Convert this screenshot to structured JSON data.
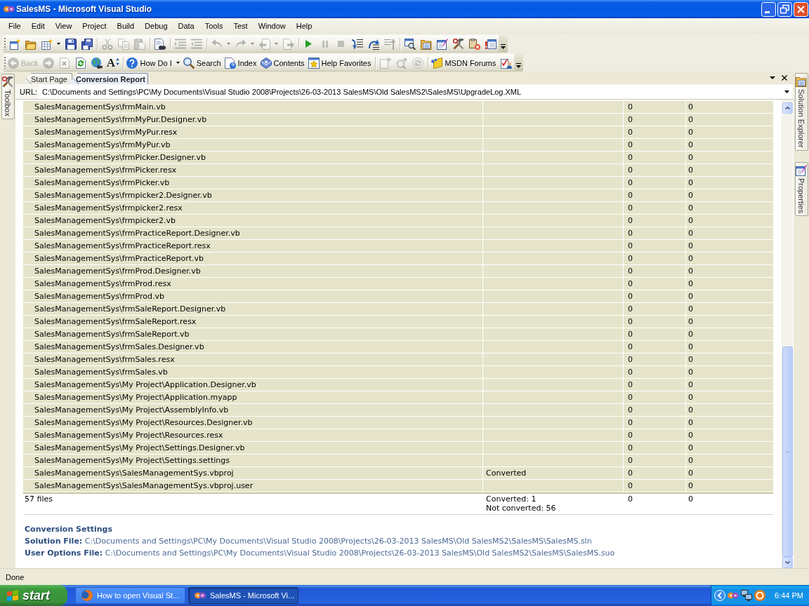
{
  "window": {
    "title": "SalesMS - Microsoft Visual Studio"
  },
  "menu": [
    "File",
    "Edit",
    "View",
    "Project",
    "Build",
    "Debug",
    "Data",
    "Tools",
    "Test",
    "Window",
    "Help"
  ],
  "toolbar_1": [
    {
      "kind": "button",
      "disabled": false
    },
    {
      "kind": "button",
      "disabled": false
    },
    {
      "kind": "button",
      "disabled": false
    },
    {
      "kind": "dropdown",
      "disabled": false
    },
    {
      "kind": "button",
      "disabled": false
    },
    {
      "kind": "button",
      "disabled": false
    },
    {
      "kind": "separator"
    },
    {
      "kind": "button",
      "disabled": true
    },
    {
      "kind": "button",
      "disabled": true
    },
    {
      "kind": "button",
      "disabled": true
    },
    {
      "kind": "separator"
    },
    {
      "kind": "button",
      "disabled": false
    },
    {
      "kind": "separator"
    },
    {
      "kind": "button",
      "disabled": true
    },
    {
      "kind": "button",
      "disabled": true
    },
    {
      "kind": "separator"
    },
    {
      "kind": "button",
      "disabled": true
    },
    {
      "kind": "dropdown",
      "disabled": true
    },
    {
      "kind": "button",
      "disabled": true
    },
    {
      "kind": "dropdown",
      "disabled": true
    },
    {
      "kind": "button",
      "disabled": true
    },
    {
      "kind": "dropdown",
      "disabled": true
    },
    {
      "kind": "button",
      "disabled": true
    },
    {
      "kind": "separator"
    },
    {
      "kind": "button",
      "disabled": false
    },
    {
      "kind": "button",
      "disabled": true
    },
    {
      "kind": "button",
      "disabled": true
    },
    {
      "kind": "button",
      "disabled": false
    },
    {
      "kind": "button",
      "disabled": false
    },
    {
      "kind": "button",
      "disabled": true
    },
    {
      "kind": "separator"
    },
    {
      "kind": "button",
      "disabled": false
    },
    {
      "kind": "button",
      "disabled": false
    },
    {
      "kind": "button",
      "disabled": false
    },
    {
      "kind": "button",
      "disabled": false
    },
    {
      "kind": "button",
      "disabled": false
    },
    {
      "kind": "button",
      "disabled": false
    },
    {
      "kind": "overflow"
    }
  ],
  "toolbar_2": [
    {
      "kind": "button",
      "label": "Back",
      "disabled": true
    },
    {
      "kind": "button",
      "disabled": true
    },
    {
      "kind": "button",
      "disabled": true
    },
    {
      "kind": "button",
      "disabled": false
    },
    {
      "kind": "button",
      "disabled": false
    },
    {
      "kind": "button",
      "glyph": "A",
      "disabled": false
    },
    {
      "kind": "separator"
    },
    {
      "kind": "button",
      "label": "How Do I",
      "disabled": false
    },
    {
      "kind": "dropdown",
      "disabled": false
    },
    {
      "kind": "button",
      "label": "Search",
      "disabled": false
    },
    {
      "kind": "button",
      "label": "Index",
      "disabled": false
    },
    {
      "kind": "button",
      "label": "Contents",
      "disabled": false
    },
    {
      "kind": "button",
      "label": "Help Favorites",
      "disabled": false
    },
    {
      "kind": "separator"
    },
    {
      "kind": "button",
      "disabled": true
    },
    {
      "kind": "button",
      "disabled": true
    },
    {
      "kind": "button",
      "disabled": true
    },
    {
      "kind": "separator"
    },
    {
      "kind": "button",
      "label": "MSDN Forums",
      "disabled": false
    },
    {
      "kind": "button",
      "disabled": false
    },
    {
      "kind": "overflow"
    }
  ],
  "left_side_tabs": [
    {
      "label": "Toolbox"
    }
  ],
  "document_tabs": [
    {
      "label": "Start Page",
      "selected": false
    },
    {
      "label": "Conversion Report",
      "selected": true
    }
  ],
  "url_bar": {
    "label": "URL:",
    "value": "C:\\Documents and Settings\\PC\\My Documents\\Visual Studio 2008\\Projects\\26-03-2013 SalesMS\\Old SalesMS2\\SalesMS\\UpgradeLog.XML"
  },
  "right_side_tabs": [
    {
      "label": "Solution Explorer"
    },
    {
      "label": "Properties"
    }
  ],
  "report": {
    "rows": [
      {
        "file": "SalesManagementSys\\frmMain.vb",
        "column_3": "0",
        "column_4": "0"
      },
      {
        "file": "SalesManagementSys\\frmMyPur.Designer.vb",
        "column_3": "0",
        "column_4": "0"
      },
      {
        "file": "SalesManagementSys\\frmMyPur.resx",
        "column_3": "0",
        "column_4": "0"
      },
      {
        "file": "SalesManagementSys\\frmMyPur.vb",
        "column_3": "0",
        "column_4": "0"
      },
      {
        "file": "SalesManagementSys\\frmPicker.Designer.vb",
        "column_3": "0",
        "column_4": "0"
      },
      {
        "file": "SalesManagementSys\\frmPicker.resx",
        "column_3": "0",
        "column_4": "0"
      },
      {
        "file": "SalesManagementSys\\frmPicker.vb",
        "column_3": "0",
        "column_4": "0"
      },
      {
        "file": "SalesManagementSys\\frmpicker2.Designer.vb",
        "column_3": "0",
        "column_4": "0"
      },
      {
        "file": "SalesManagementSys\\frmpicker2.resx",
        "column_3": "0",
        "column_4": "0"
      },
      {
        "file": "SalesManagementSys\\frmpicker2.vb",
        "column_3": "0",
        "column_4": "0"
      },
      {
        "file": "SalesManagementSys\\frmPracticeReport.Designer.vb",
        "column_3": "0",
        "column_4": "0"
      },
      {
        "file": "SalesManagementSys\\frmPracticeReport.resx",
        "column_3": "0",
        "column_4": "0"
      },
      {
        "file": "SalesManagementSys\\frmPracticeReport.vb",
        "column_3": "0",
        "column_4": "0"
      },
      {
        "file": "SalesManagementSys\\frmProd.Designer.vb",
        "column_3": "0",
        "column_4": "0"
      },
      {
        "file": "SalesManagementSys\\frmProd.resx",
        "column_3": "0",
        "column_4": "0"
      },
      {
        "file": "SalesManagementSys\\frmProd.vb",
        "column_3": "0",
        "column_4": "0"
      },
      {
        "file": "SalesManagementSys\\frmSaleReport.Designer.vb",
        "column_3": "0",
        "column_4": "0"
      },
      {
        "file": "SalesManagementSys\\frmSaleReport.resx",
        "column_3": "0",
        "column_4": "0"
      },
      {
        "file": "SalesManagementSys\\frmSaleReport.vb",
        "column_3": "0",
        "column_4": "0"
      },
      {
        "file": "SalesManagementSys\\frmSales.Designer.vb",
        "column_3": "0",
        "column_4": "0"
      },
      {
        "file": "SalesManagementSys\\frmSales.resx",
        "column_3": "0",
        "column_4": "0"
      },
      {
        "file": "SalesManagementSys\\frmSales.vb",
        "column_3": "0",
        "column_4": "0"
      },
      {
        "file": "SalesManagementSys\\My Project\\Application.Designer.vb",
        "column_3": "0",
        "column_4": "0"
      },
      {
        "file": "SalesManagementSys\\My Project\\Application.myapp",
        "column_3": "0",
        "column_4": "0"
      },
      {
        "file": "SalesManagementSys\\My Project\\AssemblyInfo.vb",
        "column_3": "0",
        "column_4": "0"
      },
      {
        "file": "SalesManagementSys\\My Project\\Resources.Designer.vb",
        "column_3": "0",
        "column_4": "0"
      },
      {
        "file": "SalesManagementSys\\My Project\\Resources.resx",
        "column_3": "0",
        "column_4": "0"
      },
      {
        "file": "SalesManagementSys\\My Project\\Settings.Designer.vb",
        "column_3": "0",
        "column_4": "0"
      },
      {
        "file": "SalesManagementSys\\My Project\\Settings.settings",
        "column_3": "0",
        "column_4": "0"
      },
      {
        "file": "SalesManagementSys\\SalesManagementSys.vbproj",
        "status": "Converted",
        "column_3": "0",
        "column_4": "0"
      },
      {
        "file": "SalesManagementSys\\SalesManagementSys.vbproj.user",
        "column_3": "0",
        "column_4": "0"
      }
    ],
    "summary": {
      "files": "57 files",
      "status_lines": [
        "Converted: 1",
        "Not converted: 56"
      ],
      "column_3": "0",
      "column_4": "0"
    }
  },
  "conversion_settings": {
    "heading": "Conversion Settings",
    "lines": [
      "**Solution File:** C:\\Documents and Settings\\PC\\My Documents\\Visual Studio 2008\\Projects\\26-03-2013 SalesMS\\Old SalesMS2\\SalesMS\\SalesMS.sln",
      "**User Options File:** C:\\Documents and Settings\\PC\\My Documents\\Visual Studio 2008\\Projects\\26-03-2013 SalesMS\\Old SalesMS2\\SalesMS\\SalesMS.suo"
    ]
  },
  "status_bar": {
    "text": "Done"
  },
  "taskbar": {
    "start": "start",
    "tasks": [
      {
        "label": "How to open Visual St...",
        "selected": false
      },
      {
        "label": "SalesMS - Microsoft Vi...",
        "selected": true
      }
    ],
    "clock": "6:44 PM"
  }
}
